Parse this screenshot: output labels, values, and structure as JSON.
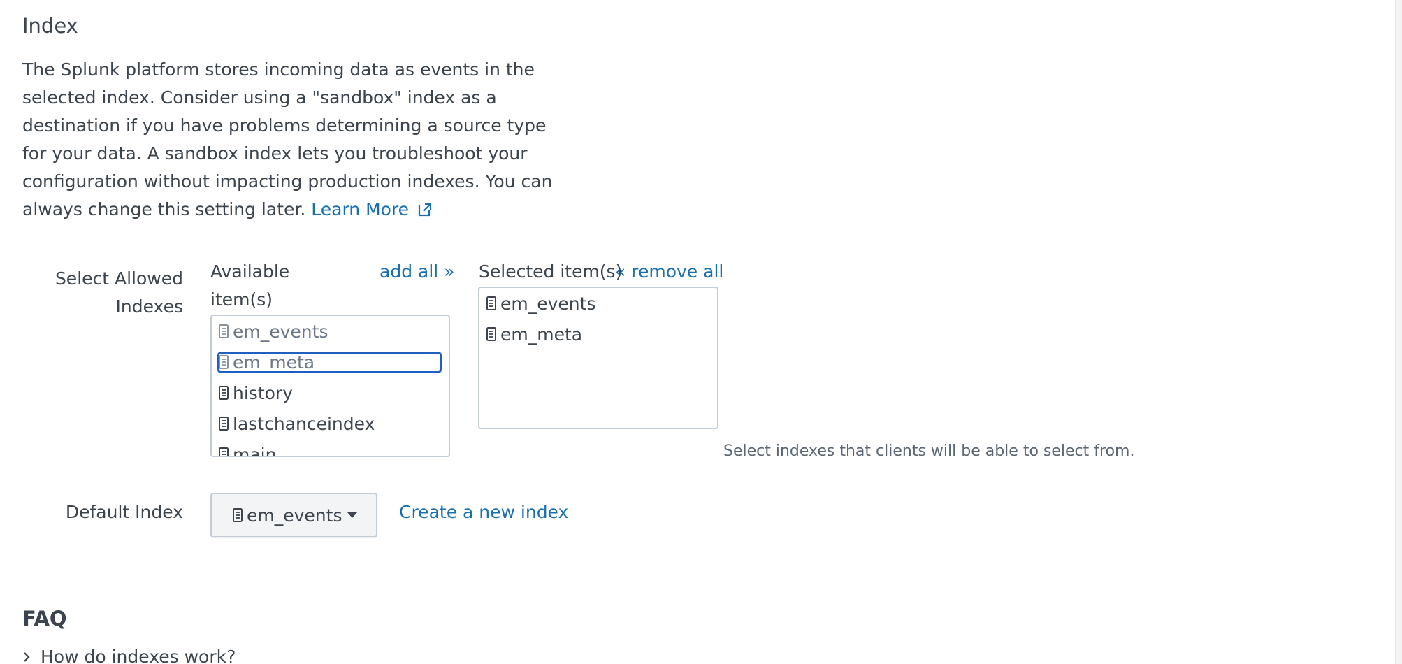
{
  "section": {
    "title": "Index",
    "description": "The Splunk platform stores incoming data as events in the selected index. Consider using a \"sandbox\" index as a destination if you have problems determining a source type for your data. A sandbox index lets you troubleshoot your configuration without impacting production indexes. You can always change this setting later.",
    "learn_more": "Learn More"
  },
  "allowed_indexes": {
    "label": "Select Allowed Indexes",
    "available_header": "Available item(s)",
    "add_all": "add all »",
    "selected_header": "Selected item(s)",
    "remove_all": "« remove all",
    "available_items": [
      "em_events",
      "em_meta",
      "history",
      "lastchanceindex",
      "main"
    ],
    "selected_items": [
      "em_events",
      "em_meta"
    ],
    "help": "Select indexes that clients will be able to select from."
  },
  "default_index": {
    "label": "Default Index",
    "value": "em_events",
    "create_link": "Create a new index"
  },
  "faq": {
    "title": "FAQ",
    "items": [
      "How do indexes work?"
    ]
  },
  "colors": {
    "link": "#1a6fb0",
    "focus": "#1f5fbf",
    "text": "#3c444d"
  }
}
